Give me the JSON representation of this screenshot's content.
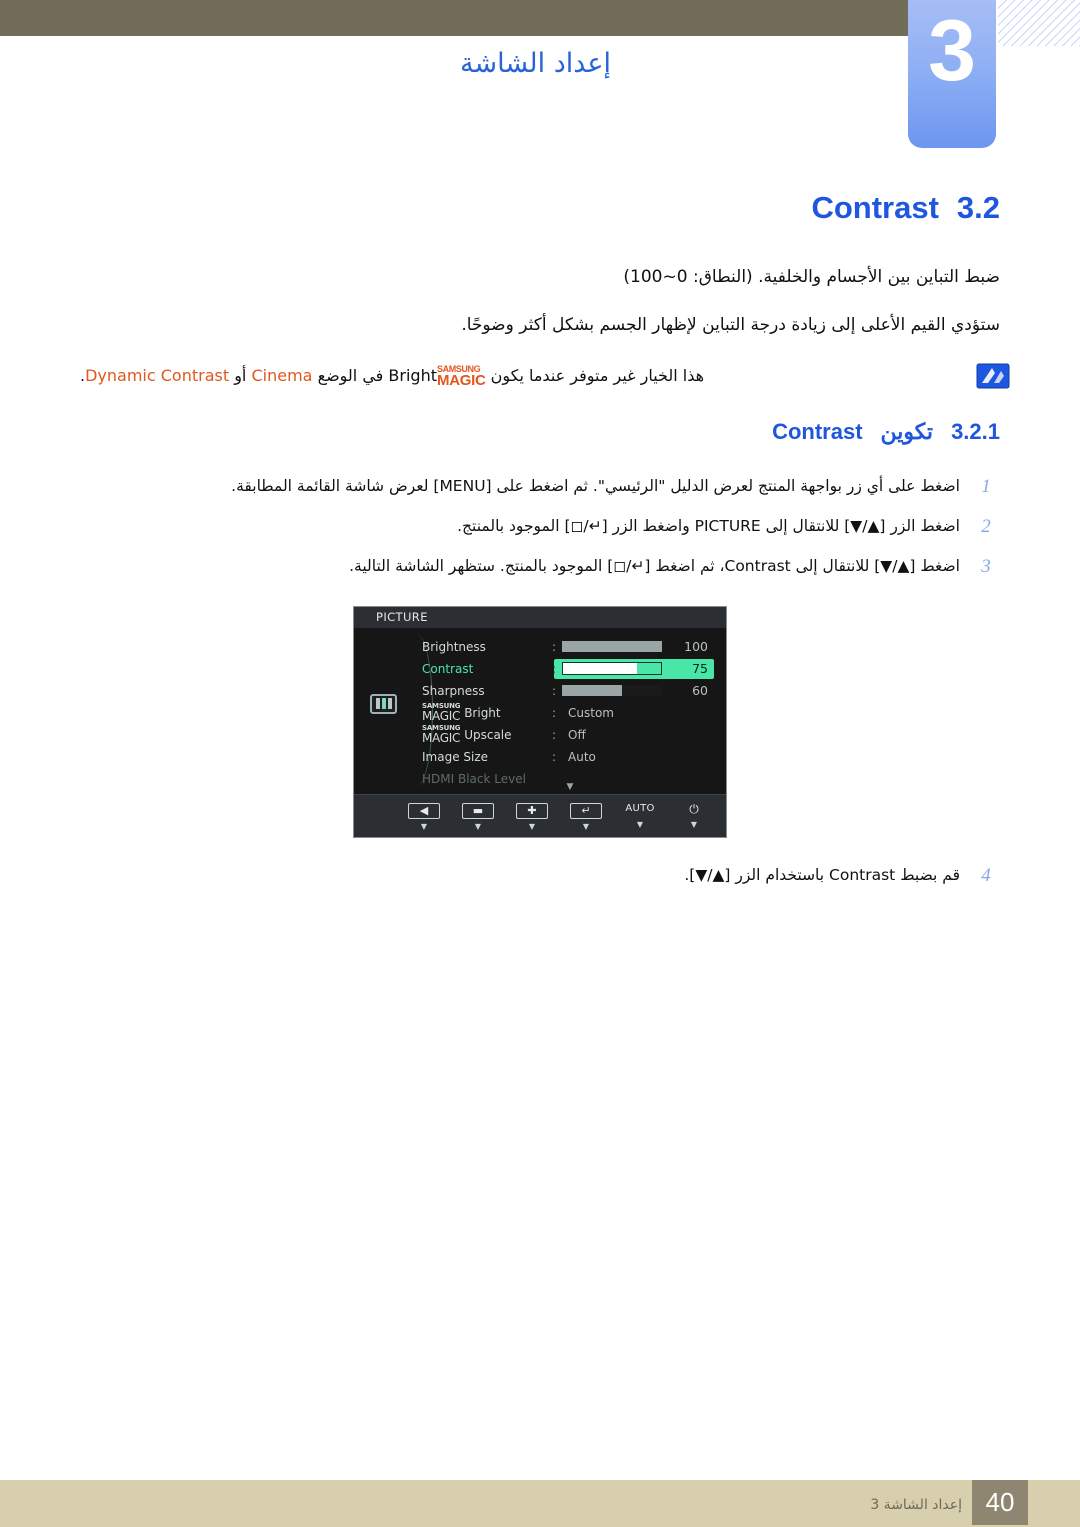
{
  "header": {
    "chapter_number": "3",
    "chapter_title": "إعداد الشاشة"
  },
  "section": {
    "number": "3.2",
    "title": "Contrast",
    "paragraphs": [
      "ضبط التباين بين الأجسام والخلفية. (النطاق: 0~100)",
      "ستؤدي القيم الأعلى إلى زيادة درجة التباين لإظهار الجسم بشكل أكثر وضوحًا."
    ],
    "note": {
      "icon": "samsung-note-icon",
      "text_before": "هذا الخيار غير متوفر عندما يكون",
      "magic_small": "SAMSUNG",
      "magic_large": "MAGIC",
      "magic_suffix": "Bright",
      "text_middle": "في الوضع",
      "mode_1": "Cinema",
      "conj": "أو",
      "mode_2": "Dynamic Contrast",
      "text_end": "."
    }
  },
  "subsection": {
    "number": "3.2.1",
    "title_ar": "تكوين",
    "title_en": "Contrast"
  },
  "steps": [
    {
      "index": "1",
      "text": "اضغط على أي زر بواجهة المنتج لعرض الدليل \"الرئيسي\". ثم اضغط على [MENU] لعرض شاشة القائمة المطابقة."
    },
    {
      "index": "2",
      "text": "اضغط الزر [▲/▼] للانتقال إلى PICTURE واضغط الزر [↵/◻] الموجود بالمنتج."
    },
    {
      "index": "3",
      "text": "اضغط [▲/▼] للانتقال إلى Contrast، ثم اضغط [↵/◻] الموجود بالمنتج. ستظهر الشاشة التالية."
    },
    {
      "index": "4",
      "text": "قم بضبط Contrast باستخدام الزر [▲/▼]."
    }
  ],
  "osd": {
    "title": "PICTURE",
    "side_icon": "picture-mode-icon",
    "rows": [
      {
        "label": "Brightness",
        "type": "slider",
        "value": "100",
        "percent": 100,
        "selected": false
      },
      {
        "label": "Contrast",
        "type": "slider",
        "value": "75",
        "percent": 75,
        "selected": true
      },
      {
        "label": "Sharpness",
        "type": "slider",
        "value": "60",
        "percent": 60,
        "selected": false
      },
      {
        "label_small": "SAMSUNG",
        "label_large": "MAGIC",
        "label_suffix": "Bright",
        "type": "option",
        "value": "Custom",
        "selected": false
      },
      {
        "label_small": "SAMSUNG",
        "label_large": "MAGIC",
        "label_suffix": "Upscale",
        "type": "option",
        "value": "Off",
        "selected": false
      },
      {
        "label": "Image Size",
        "type": "option",
        "value": "Auto",
        "selected": false
      },
      {
        "label": "HDMI Black Level",
        "type": "dim",
        "value": "",
        "selected": false
      }
    ],
    "scroll_down": "▼",
    "buttons": [
      {
        "name": "back-button",
        "glyph": "◀"
      },
      {
        "name": "minus-button",
        "glyph": "▬"
      },
      {
        "name": "plus-button",
        "glyph": "✚"
      },
      {
        "name": "enter-button",
        "glyph": "↵"
      },
      {
        "name": "auto-button",
        "glyph": "AUTO"
      },
      {
        "name": "power-button",
        "glyph": "⏻"
      }
    ]
  },
  "footer": {
    "text": "إعداد الشاشة 3",
    "page": "40"
  },
  "colors": {
    "header_band": "#716d58",
    "chapter_tab": "#8fb0f4",
    "heading_blue": "#1f56e0",
    "accent_orange": "#e2571e",
    "osd_highlight": "#49e6a8",
    "footer_band": "#d8cfae",
    "page_box": "#8e8670"
  }
}
